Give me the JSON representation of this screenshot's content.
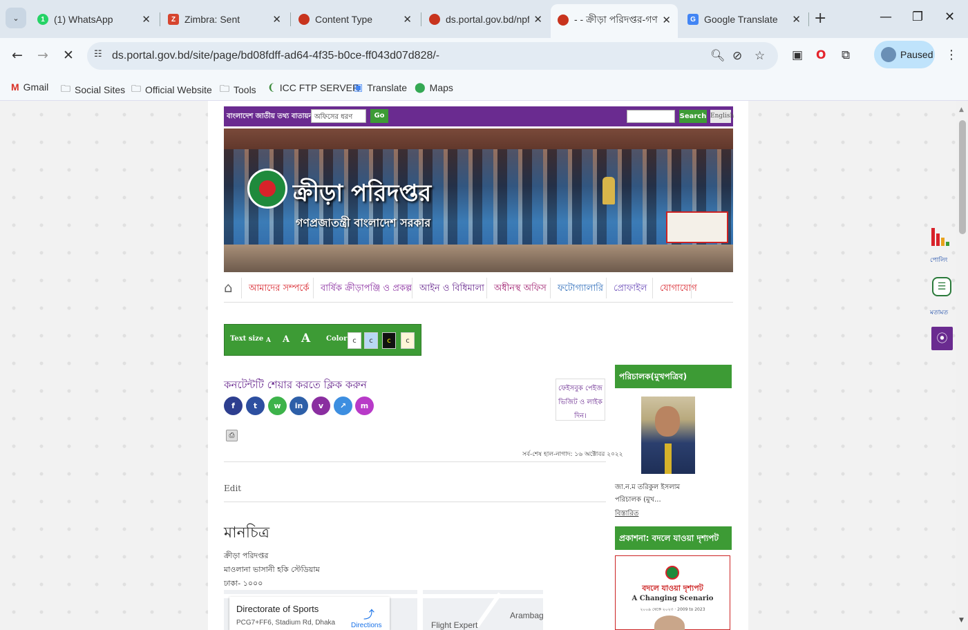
{
  "browser": {
    "tabs": [
      {
        "title": "(1) WhatsApp",
        "fav": "1",
        "color": "#25d366",
        "active": false
      },
      {
        "title": "Zimbra: Sent",
        "fav": "Z",
        "color": "#d6452f",
        "active": false
      },
      {
        "title": "Content Type",
        "fav": "●",
        "color": "#c8341e",
        "active": false
      },
      {
        "title": "ds.portal.gov.bd/npfo",
        "fav": "●",
        "color": "#c8341e",
        "active": false
      },
      {
        "title": "- - ক্রীড়া পরিদপ্তর-গণ",
        "fav": "●",
        "color": "#c8341e",
        "active": true
      },
      {
        "title": "Google Translate",
        "fav": "G",
        "color": "#4285f4",
        "active": false
      }
    ],
    "url": "ds.portal.gov.bd/site/page/bd08fdff-ad64-4f35-b0ce-ff043d07d828/-",
    "profile_label": "Paused",
    "bookmarks": [
      {
        "label": "Gmail",
        "icon": "gmail-icon"
      },
      {
        "label": "Social Sites",
        "icon": "folder-icon"
      },
      {
        "label": "Official Website",
        "icon": "folder-icon"
      },
      {
        "label": "Tools",
        "icon": "folder-icon"
      },
      {
        "label": "ICC FTP SERVER",
        "icon": "leaf-icon"
      },
      {
        "label": "Translate",
        "icon": "translate-icon"
      },
      {
        "label": "Maps",
        "icon": "map-pin-icon"
      }
    ]
  },
  "site": {
    "portal_label": "বাংলাদেশ জাতীয় তথ্য বাতায়ন",
    "office_select": "অফিসের ধরণ",
    "go_label": "Go",
    "search_label": "Search",
    "english_label": "English",
    "banner_title": "ক্রীড়া পরিদপ্তর",
    "banner_subtitle": "গণপ্রজাতন্ত্রী বাংলাদেশ সরকার",
    "nav": [
      "আমাদের সম্পর্কে",
      "বার্ষিক ক্রীড়াপঞ্জি ও প্রকল্প",
      "আইন ও বিধিমালা",
      "অধীনস্থ অফিস",
      "ফটোগ্যালারি",
      "প্রোফাইল",
      "যোগাযোগ"
    ],
    "accessibility": {
      "text_size_label": "Text size",
      "a_small": "A",
      "a_medium": "A",
      "a_large": "A",
      "color_label": "Color",
      "color_options": [
        "c",
        "c",
        "c",
        "c"
      ]
    },
    "share_title": "কনটেন্টটি শেয়ার করতে ক্লিক করুন",
    "social": [
      "f",
      "t",
      "w",
      "in",
      "v",
      "↗",
      "m"
    ],
    "fb_box": [
      "ফেইসবুক পেইজ",
      "ভিজিট ও লাইক",
      "দিন।"
    ],
    "updated": "সর্ব-শেষ হাল-নাগাদ: ১৬ অক্টোবর ২০২২",
    "edit_label": "Edit",
    "map_title": "মানচিত্র",
    "address": [
      "ক্রীড়া পরিদপ্তর",
      "মাওলানা ভাসানী হকি স্টেডিয়াম",
      "ঢাকা- ১০০০"
    ],
    "map": {
      "place_name": "Directorate of Sports",
      "place_address": "PCG7+FF6, Stadium Rd, Dhaka",
      "directions": "Directions",
      "label_1": "Arambag",
      "label_2": "Flight Expert"
    },
    "sidebar": {
      "director_head": "পরিচালক(মুখপত্রিব)",
      "director_name": "জা.ন.ম তরিকুল ইসলাম",
      "director_title": "পরিচালক (মুখ...",
      "details_link": "বিস্তারিত",
      "publication_head": "প্রকাশনা: বদলে যাওয়া দৃশ্যপট",
      "pub_title_bn": "বদলে যাওয়া দৃশ্যপট",
      "pub_title_en": "A Changing Scenario",
      "pub_sub": "২০০৯ থেকে ২০২৩ · 2009 to 2023"
    },
    "float": {
      "poll_label": "পোলিং",
      "feedback_label": "মতামত"
    }
  }
}
